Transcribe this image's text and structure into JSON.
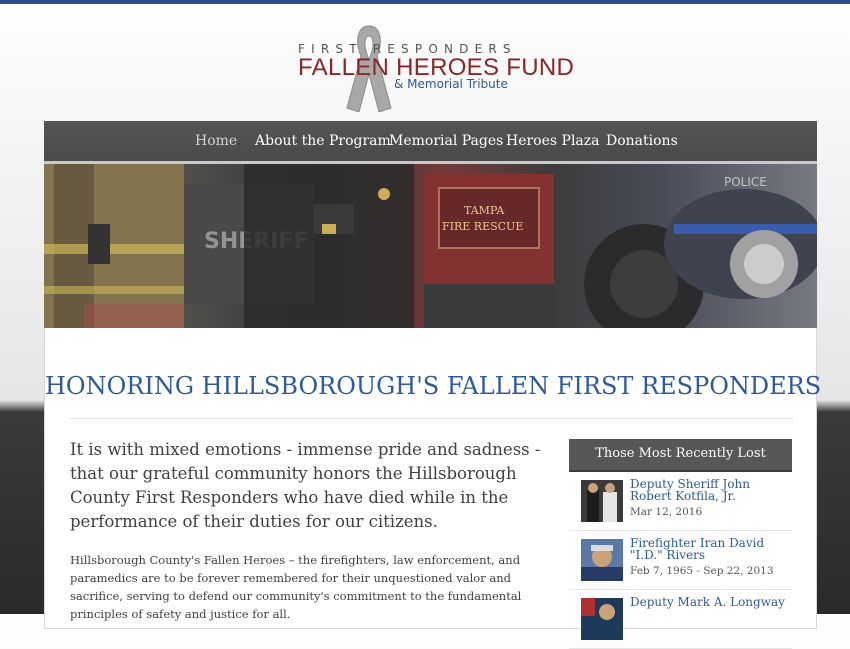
{
  "logo": {
    "line1": "FIRST RESPONDERS",
    "line2": "FALLEN HEROES FUND",
    "line3": "& Memorial Tribute"
  },
  "nav": {
    "items": [
      {
        "label": "Home",
        "active": true
      },
      {
        "label": "About the Program"
      },
      {
        "label": "Memorial Pages"
      },
      {
        "label": "Heroes Plaza"
      },
      {
        "label": "Donations"
      }
    ]
  },
  "banner": {
    "sheriff_text": "SHERIFF",
    "fire_text_1": "TAMPA",
    "fire_text_2": "FIRE RESCUE",
    "police_text": "POLICE"
  },
  "main": {
    "headline": "HONORING HILLSBOROUGH'S FALLEN FIRST RESPONDERS",
    "lead": "It is with mixed emotions - immense pride and sadness - that our grateful community honors the Hillsborough County First Responders who have died while in the performance of their duties for our citizens.",
    "body": "Hillsborough County's Fallen Heroes – the firefighters, law enforcement, and paramedics are to be forever remembered for their unquestioned valor and sacrifice, serving to defend our community's commitment to the fundamental principles of safety and justice for all."
  },
  "sidebar": {
    "title": "Those Most Recently Lost",
    "items": [
      {
        "name": "Deputy Sheriff John Robert Kotfila, Jr.",
        "date": "Mar 12, 2016"
      },
      {
        "name": "Firefighter Iran David \"I.D.\" Rivers",
        "date": "Feb 7, 1965 - Sep 22, 2013"
      },
      {
        "name": "Deputy Mark A. Longway",
        "date": ""
      }
    ]
  },
  "colors": {
    "accent_blue": "#2d5a9c",
    "logo_red": "#8c2626",
    "nav_bg": "#4f4f4f",
    "top_bar": "#2e4f86"
  }
}
